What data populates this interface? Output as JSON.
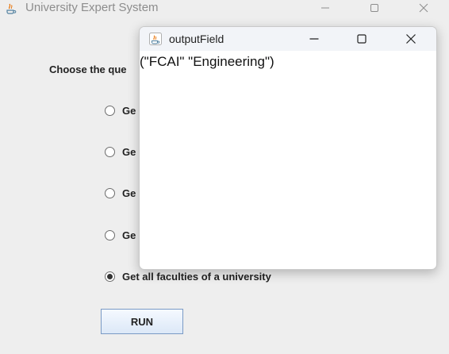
{
  "main_window": {
    "title": "University Expert System",
    "question_label": "Choose the que",
    "options": [
      {
        "label": "Ge",
        "selected": false
      },
      {
        "label": "Ge",
        "selected": false
      },
      {
        "label": "Ge",
        "selected": false
      },
      {
        "label": "Ge",
        "selected": false
      },
      {
        "label": "Get all faculties of a university",
        "selected": true
      }
    ],
    "run_label": "RUN"
  },
  "output_window": {
    "title": "outputField",
    "content": "(\"FCAI\" \"Engineering\")"
  },
  "icons": {
    "app": "java-icon",
    "minimize": "minimize-icon",
    "maximize": "maximize-icon",
    "close": "close-icon"
  },
  "colors": {
    "window_bg": "#eeeeee",
    "button_border": "#7a9ac5",
    "popup_bg": "#ffffff"
  }
}
